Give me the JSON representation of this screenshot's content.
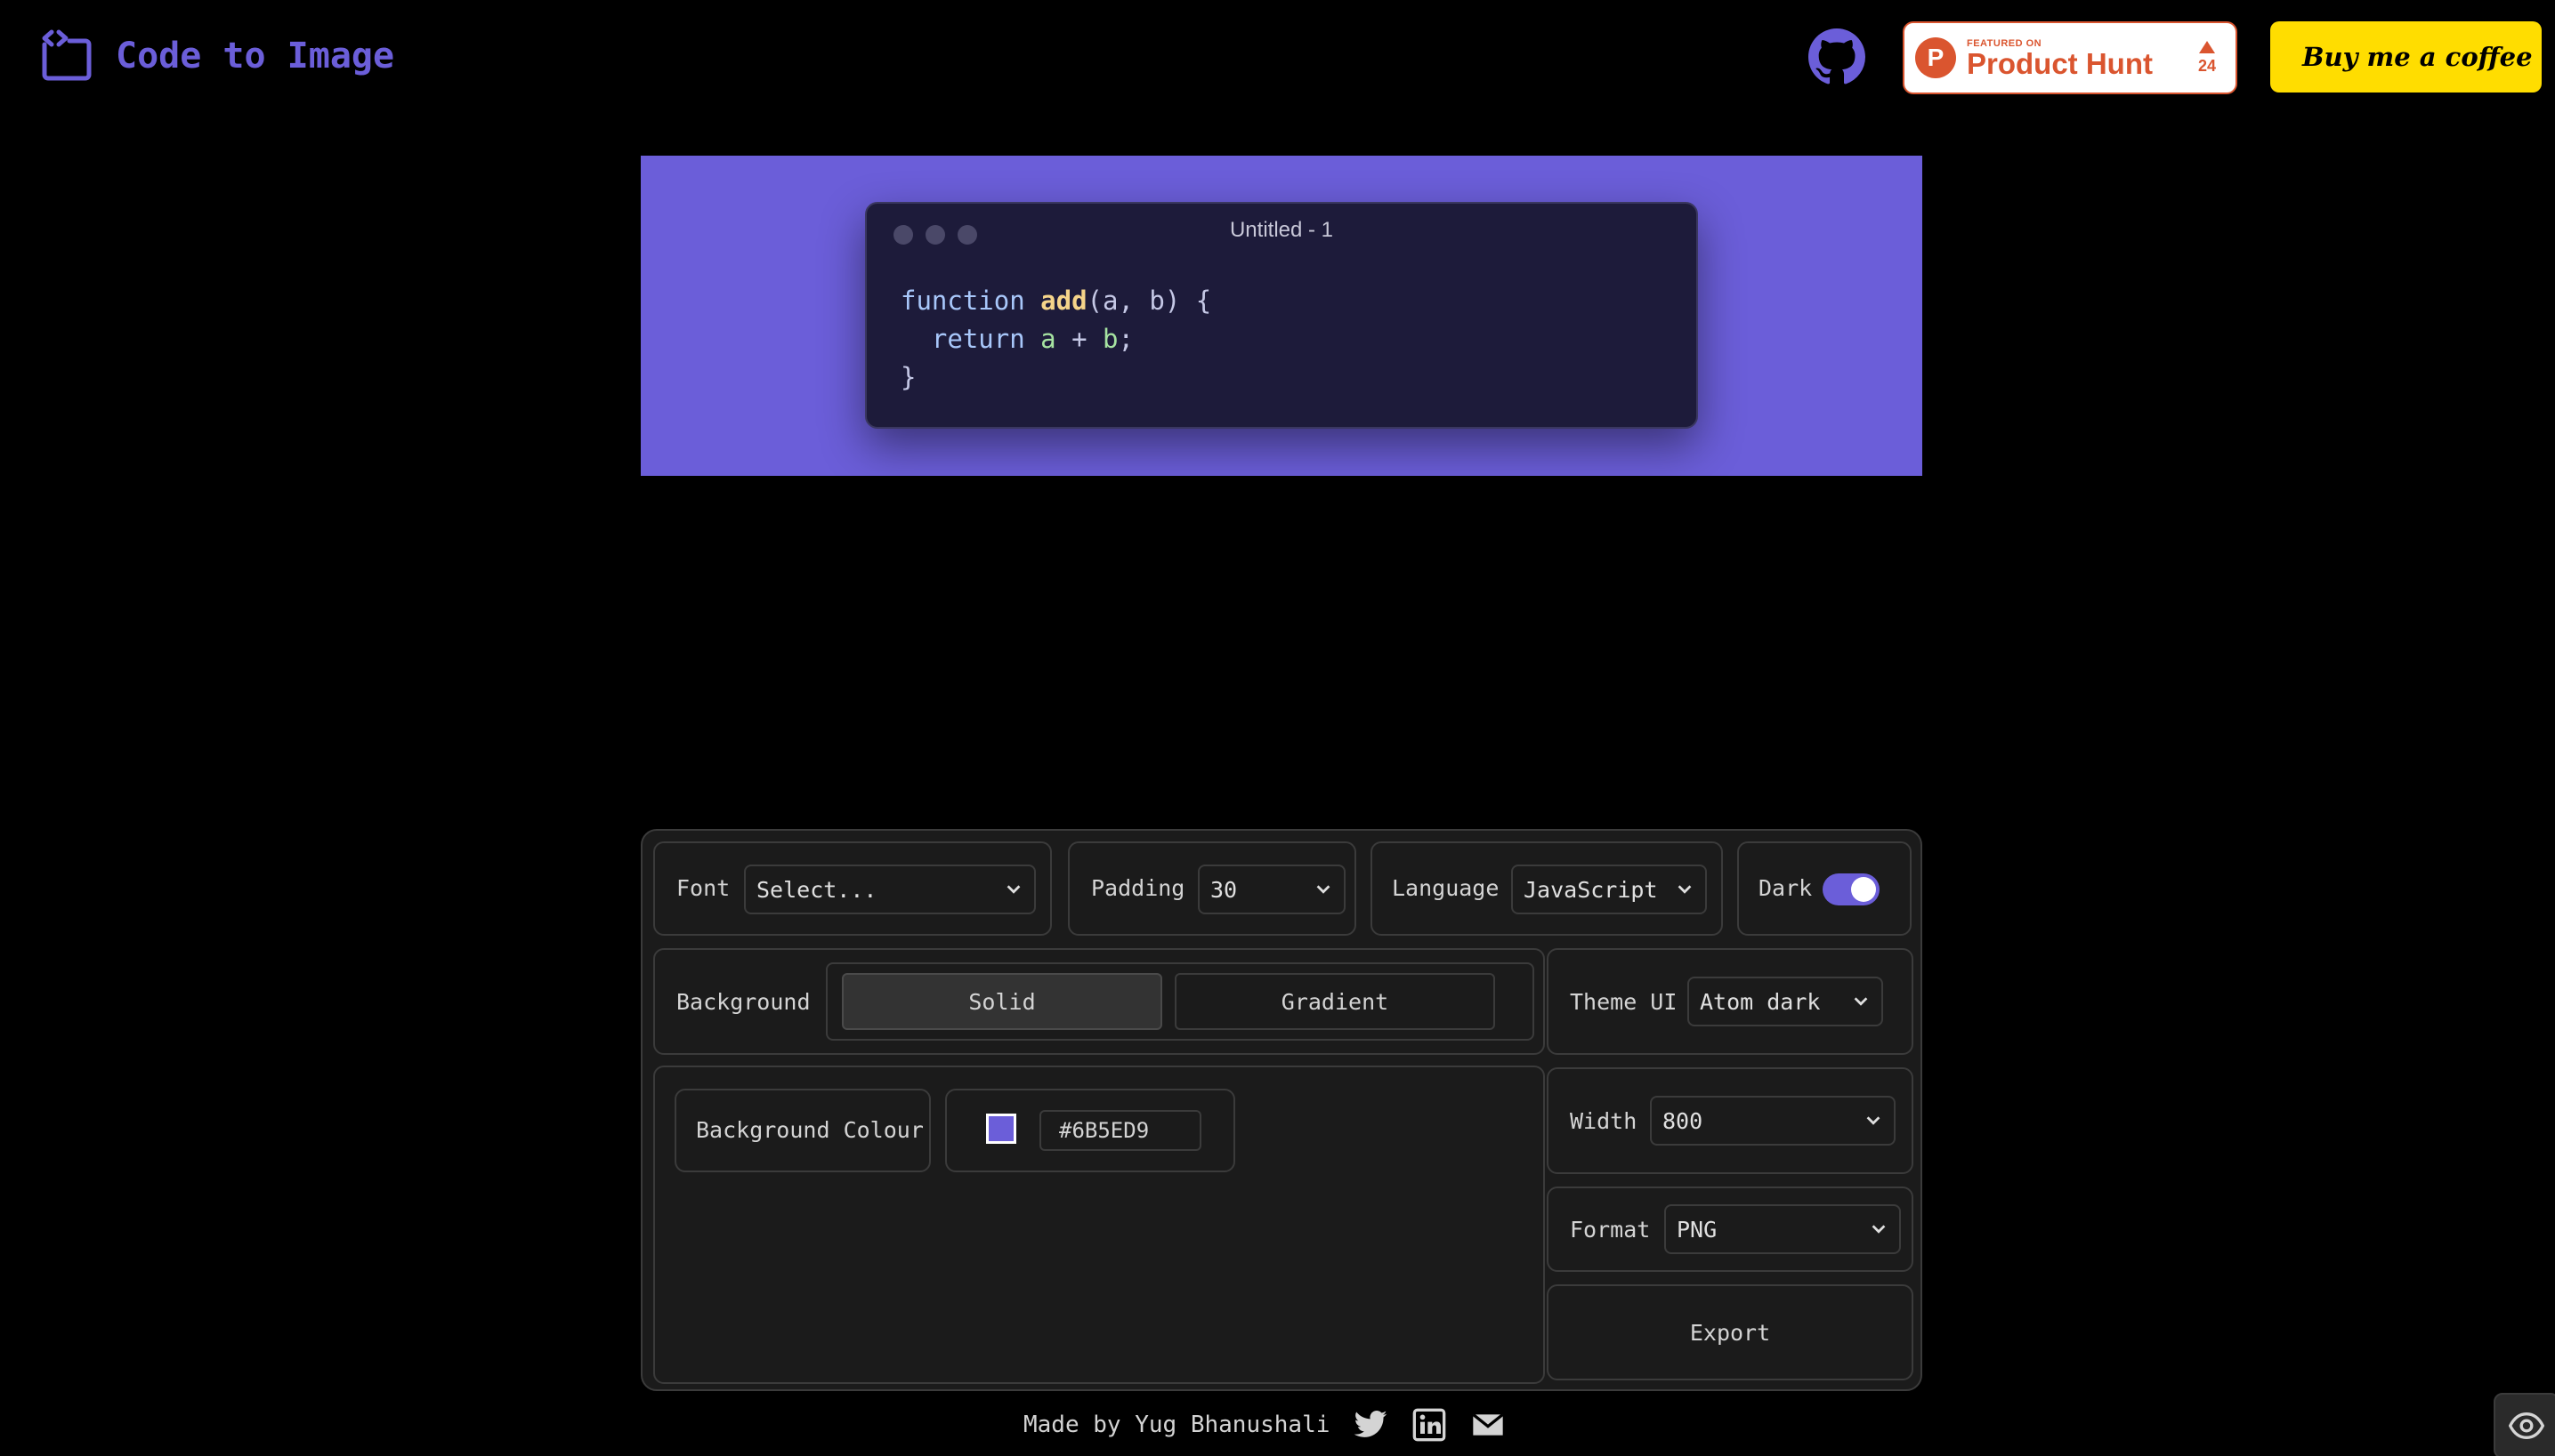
{
  "header": {
    "app_title": "Code to Image",
    "product_hunt": {
      "featured": "FEATURED ON",
      "name": "Product Hunt",
      "votes": "24",
      "logo_letter": "P"
    },
    "bmc_label": "Buy me a coffee"
  },
  "preview": {
    "window_title": "Untitled - 1",
    "code": {
      "line1": {
        "kw": "function",
        "fn": "add",
        "rest": "(a, b) {"
      },
      "line2": {
        "kw": "return",
        "a": "a",
        "op": " + ",
        "b": "b",
        "end": ";"
      },
      "line3": "}"
    },
    "background_color": "#6B5ED9"
  },
  "controls": {
    "font": {
      "label": "Font",
      "value": "Select..."
    },
    "padding": {
      "label": "Padding",
      "value": "30"
    },
    "language": {
      "label": "Language",
      "value": "JavaScript"
    },
    "dark": {
      "label": "Dark",
      "on": true
    },
    "background": {
      "label": "Background",
      "options": [
        "Solid",
        "Gradient"
      ],
      "selected": "Solid"
    },
    "theme": {
      "label": "Theme UI",
      "value": "Atom dark"
    },
    "bg_colour": {
      "label": "Background Colour",
      "hex": "#6B5ED9"
    },
    "width": {
      "label": "Width",
      "value": "800"
    },
    "format": {
      "label": "Format",
      "value": "PNG"
    },
    "export_label": "Export"
  },
  "footer": {
    "made_by": "Made by Yug Bhanushali"
  },
  "colors": {
    "accent": "#6B5ED9",
    "ph_red": "#da552f",
    "bmc_yellow": "#FFDD00"
  }
}
